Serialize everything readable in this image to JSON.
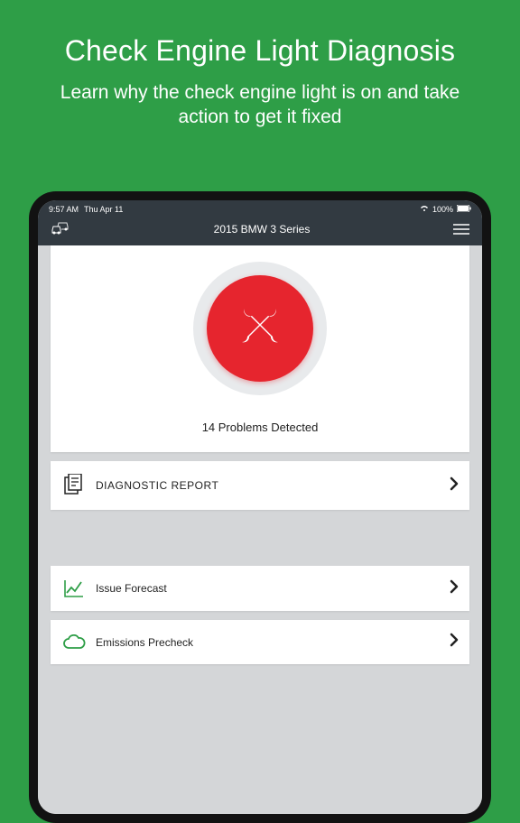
{
  "hero": {
    "title": "Check Engine Light Diagnosis",
    "subtitle": "Learn why the check engine light is on and take action to get it fixed"
  },
  "statusbar": {
    "time": "9:57 AM",
    "date": "Thu Apr 11",
    "battery": "100%"
  },
  "appbar": {
    "title": "2015 BMW 3 Series"
  },
  "problems": {
    "count_text": "14 Problems Detected"
  },
  "rows": {
    "diagnostic": "DIAGNOSTIC REPORT",
    "forecast": "Issue Forecast",
    "emissions": "Emissions Precheck"
  }
}
